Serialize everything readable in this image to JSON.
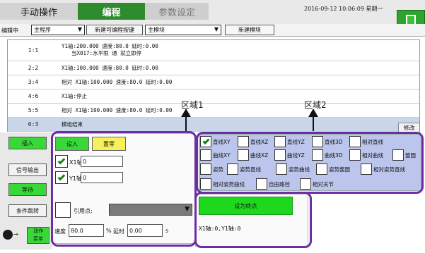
{
  "tabs": [
    {
      "label": "手动操作",
      "state": "normal"
    },
    {
      "label": "编程",
      "state": "active"
    },
    {
      "label": "参数设定",
      "state": "disabled"
    }
  ],
  "datetime": "2016-09-12  10:06:09  星期一",
  "toolbar": {
    "mode_label": "编辑中",
    "program_select": "主程序",
    "create_button": "新建可编程按键",
    "module_select": "主模块",
    "new_module_button": "新建模块"
  },
  "program_rows": [
    {
      "num": "1:1",
      "line1": "Y1轴:200.000 速度:80.0 延时:0.00",
      "line2": "当X017:水平限 通 就立即停"
    },
    {
      "num": "2:2",
      "line1": "X1轴:100.000 速度:80.0 延时:0.00"
    },
    {
      "num": "3:4",
      "line1": "相对 X1轴:100.000 速度:80.0 延时:0.00"
    },
    {
      "num": "4:6",
      "line1": "X1轴:停止"
    },
    {
      "num": "5:5",
      "line1": "相对 X1轴:100.000 速度:80.0 延时:0.00"
    },
    {
      "num": "6:3",
      "line1": "模组结束",
      "selected": true
    }
  ],
  "edit_button": "修改",
  "zone_labels": {
    "zone1": "区域1",
    "zone2": "区域2"
  },
  "left_buttons": {
    "insert": "插入",
    "signal_out": "信号输出",
    "wait": "等待",
    "cond_jump": "条件跳转",
    "action_menu": "动作\n菜单"
  },
  "zone1": {
    "setin_button": "设入",
    "zero_button": "置零",
    "axes": [
      {
        "label": "X1轴",
        "value": "0",
        "checked": true
      },
      {
        "label": "Y1轴",
        "value": "0",
        "checked": true
      }
    ],
    "ref_point_label": "引用点:",
    "speed_label": "速度",
    "speed_value": "80.0",
    "percent": "%",
    "delay_label": "延时",
    "delay_value": "0.00",
    "sec_unit": "s"
  },
  "zone2_options": [
    {
      "label": "直线XY",
      "checked": true
    },
    {
      "label": "直线XZ",
      "checked": false
    },
    {
      "label": "直线YZ",
      "checked": false
    },
    {
      "label": "直线3D",
      "checked": false
    },
    {
      "label": "相对直线",
      "checked": false
    },
    {
      "label": "曲线XY",
      "checked": false
    },
    {
      "label": "曲线XZ",
      "checked": false
    },
    {
      "label": "曲线YZ",
      "checked": false
    },
    {
      "label": "曲线3D",
      "checked": false
    },
    {
      "label": "相对曲线",
      "checked": false
    },
    {
      "label": "整圆",
      "checked": false
    },
    {
      "label": "姿势",
      "checked": false
    },
    {
      "label": "姿势直线",
      "checked": false
    },
    {
      "label": "姿势曲线",
      "checked": false
    },
    {
      "label": "姿势整圆",
      "checked": false
    },
    {
      "label": "相对姿势直线",
      "checked": false
    },
    {
      "label": "相对姿势曲线",
      "checked": false
    },
    {
      "label": "自由路径",
      "checked": false
    },
    {
      "label": "相对关节",
      "checked": false
    }
  ],
  "setpoint_button": "设为终点",
  "coords_readout": "X1轴:0,Y1轴:0",
  "colors": {
    "active_tab": "#2e8b2e",
    "button_green": "#39d839",
    "zone2_bg": "#bcc6ec",
    "selected_row": "#c9d6ea",
    "annotation_outline": "#6b2fa3"
  }
}
